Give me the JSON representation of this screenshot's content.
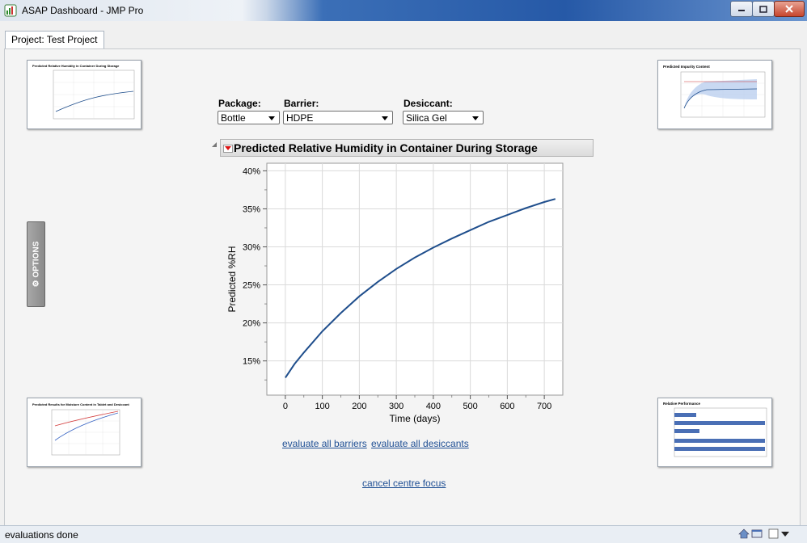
{
  "window": {
    "title": "ASAP Dashboard - JMP Pro"
  },
  "tab": {
    "label": "Project: Test Project"
  },
  "side_tab": {
    "label": "OPTIONS",
    "icon": "gear-icon"
  },
  "selectors": {
    "package": {
      "label": "Package:",
      "value": "Bottle"
    },
    "barrier": {
      "label": "Barrier:",
      "value": "HDPE"
    },
    "desiccant": {
      "label": "Desiccant:",
      "value": "Silica Gel"
    }
  },
  "report": {
    "title": "Predicted Relative Humidity in Container During Storage"
  },
  "links": {
    "evaluate_barriers": "evaluate all barriers",
    "evaluate_desiccants": "evaluate all desiccants",
    "cancel_focus": "cancel centre focus"
  },
  "thumbnails": {
    "top_left": {
      "title": "Predicted Relative Humidity in Container During Storage"
    },
    "top_right": {
      "title": "Predicted Impurity Content"
    },
    "bottom_left": {
      "title": "Predicted Results for Moisture Content in Tablet and Desiccant"
    },
    "bottom_right": {
      "title": "Relative Performance"
    }
  },
  "status": {
    "text": "evaluations done"
  },
  "colors": {
    "line": "#1f4e8c",
    "bar": "#4a6fb5",
    "link": "#1f4f94"
  },
  "chart_data": {
    "type": "line",
    "title": "Predicted Relative Humidity in Container During Storage",
    "xlabel": "Time (days)",
    "ylabel": "Predicted %RH",
    "xlim": [
      -50,
      750
    ],
    "ylim": [
      10.5,
      41
    ],
    "x_ticks": [
      0,
      100,
      200,
      300,
      400,
      500,
      600,
      700
    ],
    "y_ticks": [
      15,
      20,
      25,
      30,
      35,
      40
    ],
    "y_tick_labels": [
      "15%",
      "20%",
      "25%",
      "30%",
      "35%",
      "40%"
    ],
    "grid": true,
    "series": [
      {
        "x": [
          0,
          25,
          50,
          100,
          150,
          200,
          250,
          300,
          350,
          400,
          450,
          500,
          550,
          600,
          650,
          700,
          730
        ],
        "y": [
          12.8,
          14.6,
          16.1,
          18.9,
          21.3,
          23.5,
          25.4,
          27.1,
          28.6,
          29.9,
          31.1,
          32.2,
          33.3,
          34.2,
          35.1,
          35.9,
          36.3
        ]
      }
    ]
  }
}
